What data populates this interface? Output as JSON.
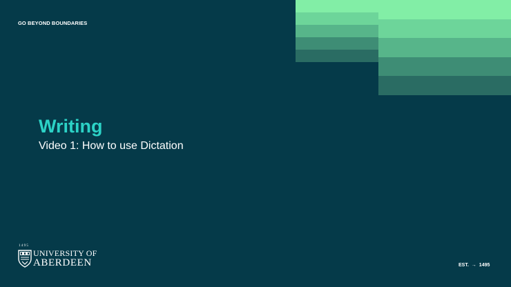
{
  "slide": {
    "tagline": "GO BEYOND BOUNDARIES",
    "title": "Writing",
    "subtitle": "Video 1: How to use Dictation"
  },
  "logo": {
    "year": "1495",
    "line1": "UNIVERSITY OF",
    "line2": "ABERDEEN",
    "crest_icon": "university-crest-icon"
  },
  "footer": {
    "est_label": "EST.",
    "arrow_icon": "arrow-right-icon",
    "arrow_glyph": "→",
    "est_year": "1495"
  },
  "colors": {
    "background": "#053a49",
    "accent": "#2cd2c6",
    "stripe_1": "#82eea6",
    "stripe_2": "#6dd59a",
    "stripe_3": "#57b58a",
    "stripe_4": "#3e8d75",
    "stripe_5": "#2a6c63"
  }
}
